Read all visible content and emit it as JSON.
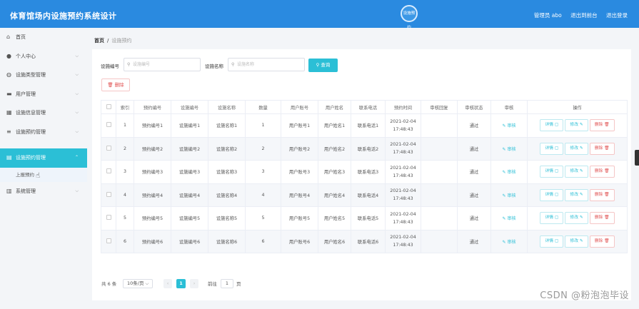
{
  "header": {
    "title": "体育馆场内设施预约系统设计",
    "logo_text": "设施预约",
    "nav": [
      "管理员 abo",
      "退出到前台",
      "退出登录"
    ]
  },
  "sidebar": {
    "items": [
      {
        "label": "首页",
        "icon": "home-icon",
        "glyph": "⌂"
      },
      {
        "label": "个人中心",
        "icon": "user-icon",
        "glyph": "●"
      },
      {
        "label": "设施类型管理",
        "icon": "pin-icon",
        "glyph": "◍"
      },
      {
        "label": "用户管理",
        "icon": "user-group-icon",
        "glyph": "▬"
      },
      {
        "label": "设施信息管理",
        "icon": "grid-icon",
        "glyph": "▦"
      },
      {
        "label": "设施预约管理",
        "icon": "list-icon",
        "glyph": "≡"
      },
      {
        "label": "设施预约管理",
        "icon": "calendar-icon",
        "glyph": "▤"
      }
    ],
    "active_sub": "上报预约",
    "system": {
      "label": "系统管理",
      "icon": "bank-icon",
      "glyph": "▥"
    }
  },
  "breadcrumb": {
    "home": "首页",
    "current": "设施预约"
  },
  "search": {
    "label1": "设施编号",
    "placeholder1": "设施编号",
    "label2": "设施名称",
    "placeholder2": "设施名称",
    "query_label": "查询",
    "delete_label": "删除"
  },
  "table": {
    "headers": [
      "索引",
      "预约编号",
      "设施编号",
      "设施名称",
      "数量",
      "用户账号",
      "用户姓名",
      "联系电话",
      "预约时间",
      "审核回复",
      "审核状态",
      "审核",
      "操作"
    ],
    "rows": [
      {
        "idx": "1",
        "order": "预约编号1",
        "code": "设施编号1",
        "name": "设施名称1",
        "qty": "1",
        "account": "用户账号1",
        "uname": "用户姓名1",
        "phone": "联系电话1",
        "date": "2021-02-04",
        "time": "17:48:43",
        "reply": "",
        "status": "通过",
        "audit": "审核"
      },
      {
        "idx": "2",
        "order": "预约编号2",
        "code": "设施编号2",
        "name": "设施名称2",
        "qty": "2",
        "account": "用户账号2",
        "uname": "用户姓名2",
        "phone": "联系电话2",
        "date": "2021-02-04",
        "time": "17:48:43",
        "reply": "",
        "status": "通过",
        "audit": "审核"
      },
      {
        "idx": "3",
        "order": "预约编号3",
        "code": "设施编号3",
        "name": "设施名称3",
        "qty": "3",
        "account": "用户账号3",
        "uname": "用户姓名3",
        "phone": "联系电话3",
        "date": "2021-02-04",
        "time": "17:48:43",
        "reply": "",
        "status": "通过",
        "audit": "审核"
      },
      {
        "idx": "4",
        "order": "预约编号4",
        "code": "设施编号4",
        "name": "设施名称4",
        "qty": "4",
        "account": "用户账号4",
        "uname": "用户姓名4",
        "phone": "联系电话4",
        "date": "2021-02-04",
        "time": "17:48:43",
        "reply": "",
        "status": "通过",
        "audit": "审核"
      },
      {
        "idx": "5",
        "order": "预约编号5",
        "code": "设施编号5",
        "name": "设施名称5",
        "qty": "5",
        "account": "用户账号5",
        "uname": "用户姓名5",
        "phone": "联系电话5",
        "date": "2021-02-04",
        "time": "17:48:43",
        "reply": "",
        "status": "通过",
        "audit": "审核"
      },
      {
        "idx": "6",
        "order": "预约编号6",
        "code": "设施编号6",
        "name": "设施名称6",
        "qty": "6",
        "account": "用户账号6",
        "uname": "用户姓名6",
        "phone": "联系电话6",
        "date": "2021-02-04",
        "time": "17:48:43",
        "reply": "",
        "status": "通过",
        "audit": "审核"
      }
    ],
    "actions": {
      "detail": "详情",
      "edit": "修改",
      "delete": "删除"
    }
  },
  "pagination": {
    "total": "共 6 条",
    "page_size": "10条/页",
    "current_page": "1",
    "goto_label": "前往",
    "goto_value": "1",
    "page_suffix": "页"
  },
  "watermark": "CSDN @粉泡泡毕设",
  "colors": {
    "header": "#2a8ae0",
    "accent": "#2bbfd6",
    "danger": "#e05050"
  }
}
